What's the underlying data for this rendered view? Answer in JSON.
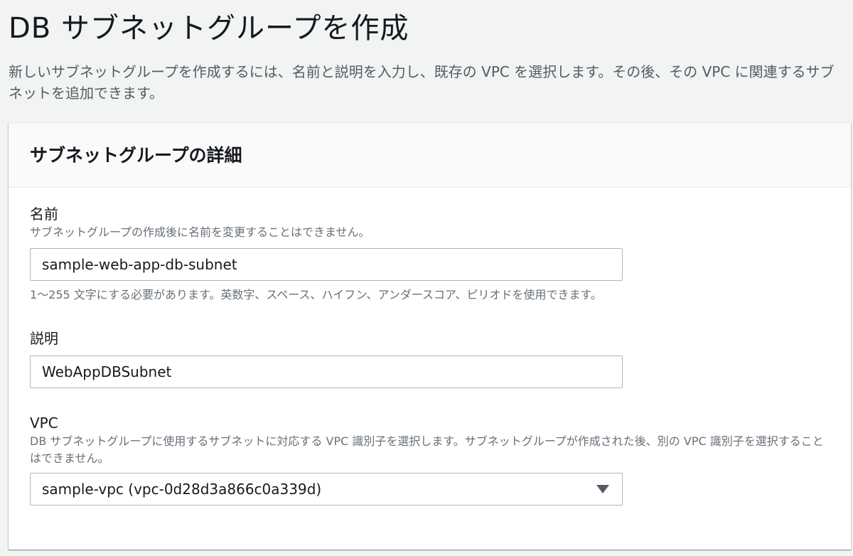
{
  "page": {
    "title": "DB サブネットグループを作成",
    "description": "新しいサブネットグループを作成するには、名前と説明を入力し、既存の VPC を選択します。その後、その VPC に関連するサブネットを追加できます。"
  },
  "panel": {
    "title": "サブネットグループの詳細",
    "name_field": {
      "label": "名前",
      "description": "サブネットグループの作成後に名前を変更することはできません。",
      "value": "sample-web-app-db-subnet",
      "constraint": "1〜255 文字にする必要があります。英数字、スペース、ハイフン、アンダースコア、ピリオドを使用できます。"
    },
    "description_field": {
      "label": "説明",
      "value": "WebAppDBSubnet"
    },
    "vpc_field": {
      "label": "VPC",
      "description": "DB サブネットグループに使用するサブネットに対応する VPC 識別子を選択します。サブネットグループが作成された後、別の VPC 識別子を選択することはできません。",
      "selected": "sample-vpc (vpc-0d28d3a866c0a339d)",
      "icon": "caret-down-icon"
    }
  },
  "colors": {
    "page_background": "#f2f3f3",
    "panel_background": "#ffffff",
    "header_background": "#fafafa",
    "input_border": "#aab7b8",
    "secondary_text": "#687078"
  }
}
